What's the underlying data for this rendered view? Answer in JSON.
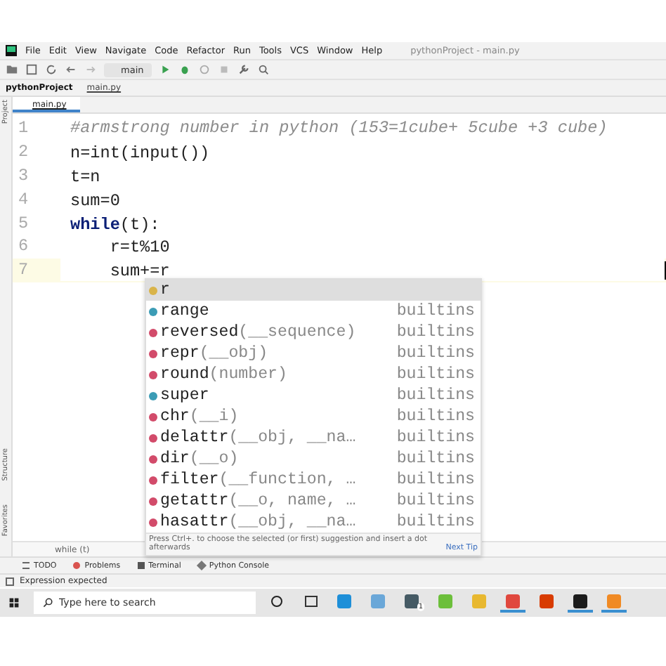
{
  "menu": [
    "File",
    "Edit",
    "View",
    "Navigate",
    "Code",
    "Refactor",
    "Run",
    "Tools",
    "VCS",
    "Window",
    "Help"
  ],
  "window": {
    "title": "pythonProject - main.py"
  },
  "toolbar": {
    "run_config": "main"
  },
  "breadcrumb": [
    "pythonProject",
    "main.py"
  ],
  "side_tabs": [
    "Project",
    "Structure",
    "Favorites"
  ],
  "tabs": [
    {
      "label": "main.py",
      "selected": true
    }
  ],
  "code": [
    {
      "number": "1",
      "text": "#armstrong number in python (153=1cube+ 5cube +3 cube)",
      "kind": "comment",
      "current": false
    },
    {
      "number": "2",
      "text": "n=int(input())",
      "kind": "code",
      "current": false
    },
    {
      "number": "3",
      "text": "t=n",
      "kind": "code",
      "current": false
    },
    {
      "number": "4",
      "text": "sum=0",
      "kind": "code",
      "current": false
    },
    {
      "number": "5",
      "text": "**while**(t):",
      "kind": "code",
      "current": false
    },
    {
      "number": "6",
      "text": "    r=t%10",
      "kind": "code",
      "current": false
    },
    {
      "number": "7",
      "text": "    sum+=r",
      "kind": "code",
      "current": true
    }
  ],
  "completion": {
    "items": [
      {
        "name": "r",
        "kind": "variable",
        "selected": true
      },
      {
        "name": "range",
        "kind": "class",
        "source": "builtins",
        "selected": false
      },
      {
        "name": "reversed",
        "args": "(__sequence)",
        "kind": "function",
        "source": "builtins",
        "selected": false
      },
      {
        "name": "repr",
        "args": "(__obj)",
        "kind": "function",
        "source": "builtins",
        "selected": false
      },
      {
        "name": "round",
        "args": "(number)",
        "kind": "function",
        "source": "builtins",
        "selected": false
      },
      {
        "name": "super",
        "kind": "class",
        "source": "builtins",
        "selected": false
      },
      {
        "name": "chr",
        "args": "(__i)",
        "kind": "function",
        "source": "builtins",
        "selected": false
      },
      {
        "name": "delattr",
        "args": "(__obj, __na…",
        "kind": "function",
        "source": "builtins",
        "selected": false
      },
      {
        "name": "dir",
        "args": "(__o)",
        "kind": "function",
        "source": "builtins",
        "selected": false
      },
      {
        "name": "filter",
        "args": "(__function, …",
        "kind": "function",
        "source": "builtins",
        "selected": false
      },
      {
        "name": "getattr",
        "args": "(__o, name, …",
        "kind": "function",
        "source": "builtins",
        "selected": false
      },
      {
        "name": "hasattr",
        "args": "(__obj, __na…",
        "kind": "function",
        "source": "builtins",
        "selected": false
      }
    ],
    "hint": "Press Ctrl+. to choose the selected (or first) suggestion and insert a dot afterwards",
    "tip_link": "Next Tip"
  },
  "code_breadcrumb": "while (t)",
  "tool_tabs": [
    {
      "label": "TODO",
      "kind": "todo"
    },
    {
      "label": "Problems",
      "kind": "problems"
    },
    {
      "label": "Terminal",
      "kind": "terminal"
    },
    {
      "label": "Python Console",
      "kind": "console"
    }
  ],
  "status_bar": "Expression expected",
  "taskbar": {
    "search": {
      "placeholder": "Type here to search"
    },
    "apps": [
      {
        "kind": "cortana"
      },
      {
        "kind": "taskview"
      },
      {
        "kind": "edge",
        "running": false
      },
      {
        "kind": "blue",
        "running": false
      },
      {
        "kind": "mail",
        "running": false,
        "badge": "1"
      },
      {
        "kind": "torrent",
        "running": false
      },
      {
        "kind": "folder",
        "running": false
      },
      {
        "kind": "chrome",
        "running": true
      },
      {
        "kind": "office",
        "running": false
      },
      {
        "kind": "pycharm",
        "running": true
      },
      {
        "kind": "orange",
        "running": true
      }
    ]
  }
}
